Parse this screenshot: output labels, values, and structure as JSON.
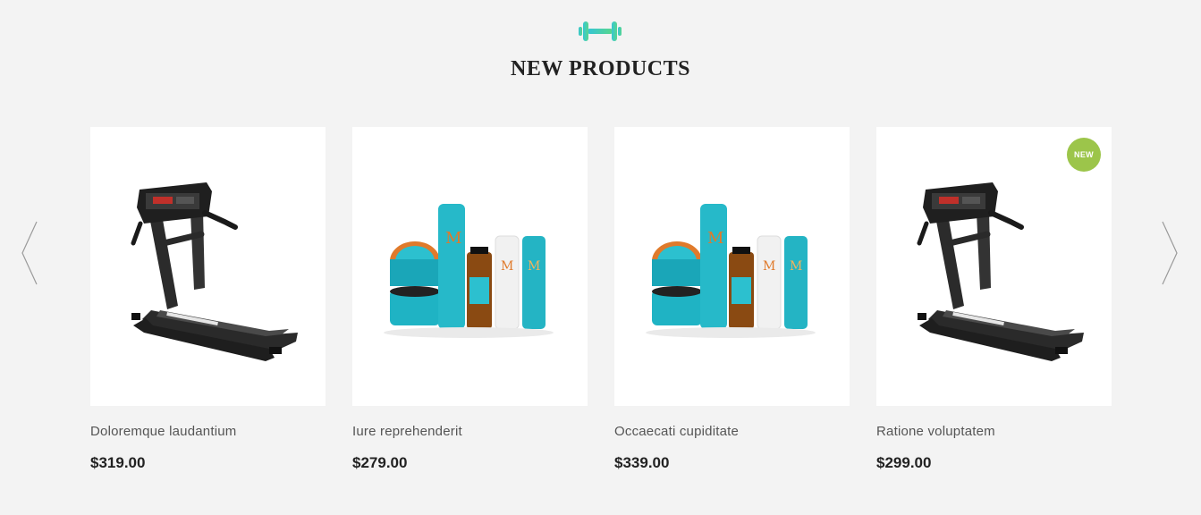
{
  "section": {
    "title": "NEW PRODUCTS",
    "icon": "dumbbell-icon",
    "accent_color": "#3ec9c0"
  },
  "carousel": {
    "prev_icon": "chevron-left-icon",
    "next_icon": "chevron-right-icon"
  },
  "products": [
    {
      "name": "Doloremque laudantium",
      "price": "$319.00",
      "image": "treadmill-image",
      "badge": ""
    },
    {
      "name": "Iure reprehenderit",
      "price": "$279.00",
      "image": "haircare-products-image",
      "badge": ""
    },
    {
      "name": "Occaecati cupiditate",
      "price": "$339.00",
      "image": "haircare-products-image",
      "badge": ""
    },
    {
      "name": "Ratione voluptatem",
      "price": "$299.00",
      "image": "treadmill-image",
      "badge": "NEW"
    }
  ],
  "badge_color": "#9cc54a"
}
